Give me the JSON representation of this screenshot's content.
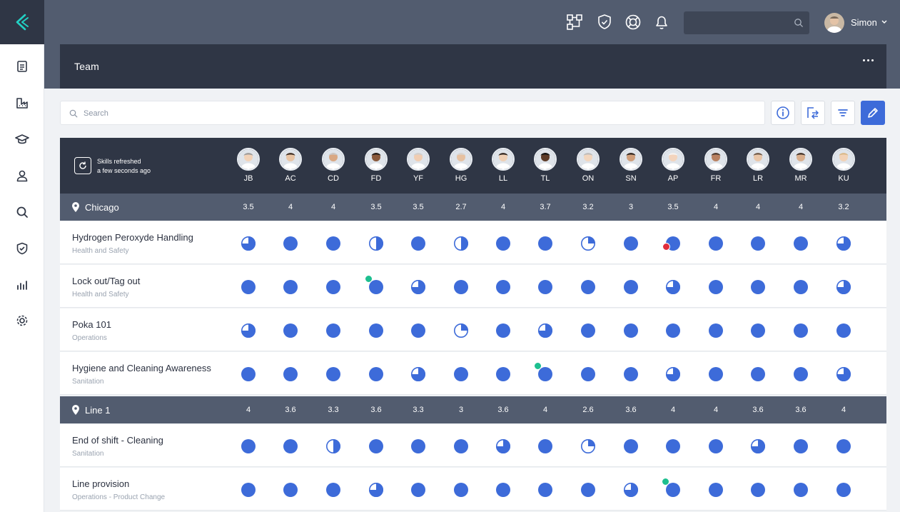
{
  "app": {
    "accent": "#3d6bd9",
    "user_name": "Simon",
    "top_search_value": ""
  },
  "page": {
    "title": "Team"
  },
  "search": {
    "placeholder": "Search",
    "value": ""
  },
  "status": {
    "refresh_line1": "Skills refreshed",
    "refresh_line2": "a few seconds ago"
  },
  "sidebar_items": [
    "document-icon",
    "factory-icon",
    "graduation-cap-icon",
    "user-icon",
    "search-icon",
    "shield-check-icon",
    "bar-chart-icon",
    "gear-icon"
  ],
  "top_icons": [
    "workflow-icon",
    "shield-check-icon",
    "help-lifebuoy-icon",
    "bell-icon"
  ],
  "toolbar_icons": [
    "info-icon",
    "swap-icon",
    "filter-icon",
    "edit-pencil-icon"
  ],
  "people": [
    "JB",
    "AC",
    "CD",
    "FD",
    "YF",
    "HG",
    "LL",
    "TL",
    "ON",
    "SN",
    "AP",
    "FR",
    "LR",
    "MR",
    "KU"
  ],
  "groups": [
    {
      "name": "Chicago",
      "scores": [
        "3.5",
        "4",
        "4",
        "3.5",
        "3.5",
        "2.7",
        "4",
        "3.7",
        "3.2",
        "3",
        "3.5",
        "4",
        "4",
        "4",
        "3.2"
      ],
      "skills": [
        {
          "name": "Hydrogen Peroxyde Handling",
          "category": "Health and Safety",
          "levels": [
            3,
            4,
            4,
            2,
            4,
            2,
            4,
            4,
            1,
            4,
            4,
            4,
            4,
            4,
            3
          ],
          "badges": [
            {
              "index": 10,
              "type": "warn"
            }
          ]
        },
        {
          "name": "Lock out/Tag out",
          "category": "Health and Safety",
          "levels": [
            4,
            4,
            4,
            4,
            3,
            4,
            4,
            4,
            4,
            4,
            3,
            4,
            4,
            4,
            3
          ],
          "badges": [
            {
              "index": 3,
              "type": "ok"
            }
          ]
        },
        {
          "name": "Poka 101",
          "category": "Operations",
          "levels": [
            3,
            4,
            4,
            4,
            4,
            1,
            4,
            3,
            4,
            4,
            4,
            4,
            4,
            4,
            4
          ],
          "badges": []
        },
        {
          "name": "Hygiene and Cleaning Awareness",
          "category": "Sanitation",
          "levels": [
            4,
            4,
            4,
            4,
            3,
            4,
            4,
            4,
            4,
            4,
            3,
            4,
            4,
            4,
            3
          ],
          "badges": [
            {
              "index": 7,
              "type": "ok"
            }
          ]
        }
      ]
    },
    {
      "name": "Line 1",
      "scores": [
        "4",
        "3.6",
        "3.3",
        "3.6",
        "3.3",
        "3",
        "3.6",
        "4",
        "2.6",
        "3.6",
        "4",
        "4",
        "3.6",
        "3.6",
        "4"
      ],
      "skills": [
        {
          "name": "End of shift - Cleaning",
          "category": "Sanitation",
          "levels": [
            4,
            4,
            2,
            4,
            4,
            4,
            3,
            4,
            1,
            4,
            4,
            4,
            3,
            4,
            4
          ],
          "badges": []
        },
        {
          "name": "Line provision",
          "category": "Operations - Product Change",
          "levels": [
            4,
            4,
            4,
            3,
            4,
            4,
            4,
            4,
            4,
            3,
            4,
            4,
            4,
            4,
            4
          ],
          "badges": [
            {
              "index": 10,
              "type": "ok"
            }
          ]
        }
      ]
    }
  ]
}
